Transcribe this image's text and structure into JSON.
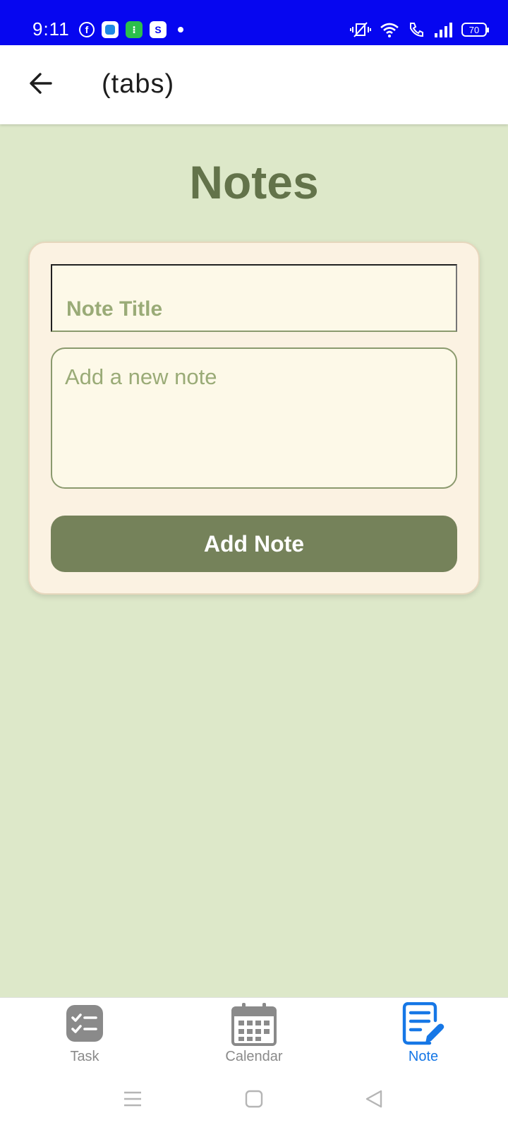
{
  "status_bar": {
    "time": "9:11",
    "battery": "70",
    "left_icons": [
      "facebook-icon",
      "app-icon",
      "app-icon",
      "shop-icon",
      "dot"
    ],
    "right_icons": [
      "vibrate-icon",
      "wifi-icon",
      "call-icon",
      "signal-icon",
      "battery-icon"
    ],
    "shop_glyph": "S",
    "background": "#0606f0"
  },
  "header": {
    "title": "(tabs)",
    "back_icon": "arrow-left-icon"
  },
  "page": {
    "title": "Notes",
    "background": "#dde8c9",
    "title_color": "#63734a"
  },
  "form": {
    "title_placeholder": "Note Title",
    "note_placeholder": "Add a new note",
    "add_button_label": "Add Note",
    "button_color": "#75825a"
  },
  "bottom_nav": {
    "items": [
      {
        "label": "Task",
        "icon": "checklist-icon",
        "active": false
      },
      {
        "label": "Calendar",
        "icon": "calendar-icon",
        "active": false
      },
      {
        "label": "Note",
        "icon": "note-edit-icon",
        "active": true
      }
    ],
    "active_color": "#1677e6",
    "inactive_color": "#8a8a8a"
  },
  "system_nav": {
    "buttons": [
      "menu-icon",
      "home-icon",
      "back-triangle-icon"
    ]
  }
}
